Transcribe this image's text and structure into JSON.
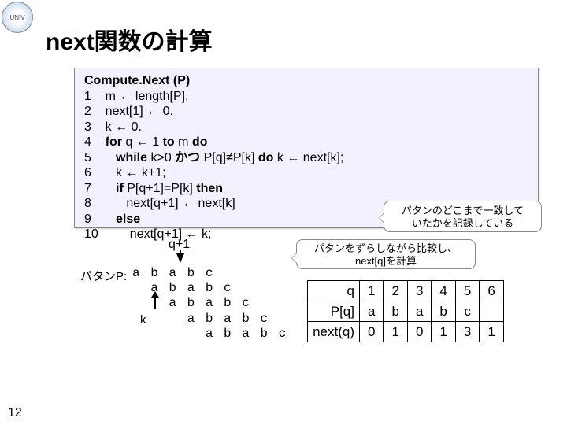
{
  "title": "next関数の計算",
  "page_number": "12",
  "code": {
    "header": "Compute.Next (P)",
    "lines": [
      {
        "n": "1",
        "pre": "",
        "body": "m ← length[P]."
      },
      {
        "n": "2",
        "pre": "",
        "body": "next[1] ← 0."
      },
      {
        "n": "3",
        "pre": "",
        "body": "k ← 0."
      },
      {
        "n": "4",
        "pre": "",
        "body": "",
        "bold_parts": [
          "for",
          " q ← 1 ",
          "to",
          " m ",
          "do"
        ]
      },
      {
        "n": "5",
        "pre": "   ",
        "body": "",
        "bold_parts": [
          "while",
          " k>0 ",
          "かつ",
          " P[q]≠P[k] ",
          "do",
          " k ← next[k];"
        ]
      },
      {
        "n": "6",
        "pre": "   ",
        "body": "k ← k+1;"
      },
      {
        "n": "7",
        "pre": "   ",
        "body": "",
        "bold_parts": [
          "if",
          " P[q+1]=P[k] ",
          "then"
        ]
      },
      {
        "n": "8",
        "pre": "      ",
        "body": "next[q+1] ← next[k]"
      },
      {
        "n": "9",
        "pre": "   ",
        "body": "",
        "bold_parts": [
          "else"
        ]
      },
      {
        "n": "10",
        "pre": "      ",
        "body": "next[q+1] ← k;"
      }
    ]
  },
  "callout1": {
    "l1": "パタンのどこまで一致して",
    "l2": "いたかを記録している"
  },
  "callout2": {
    "l1": "パタンをずらしながら比較し、",
    "l2": "next[q]を計算"
  },
  "q_label": "q+1",
  "k_label": "k",
  "pattern_label": "パタンP:",
  "pattern_shifts": [
    "a b a b c",
    "  a b a b c",
    "    a b a b c",
    "      a b a b c",
    "        a b a b c"
  ],
  "table": {
    "headers": [
      "q",
      "P[q]",
      "next(q)"
    ],
    "cols": [
      "1",
      "2",
      "3",
      "4",
      "5",
      "6"
    ],
    "row1": [
      "a",
      "b",
      "a",
      "b",
      "c",
      ""
    ],
    "row2": [
      "0",
      "1",
      "0",
      "1",
      "3",
      "1"
    ]
  },
  "icons": {
    "logo_text": "UNIV"
  }
}
